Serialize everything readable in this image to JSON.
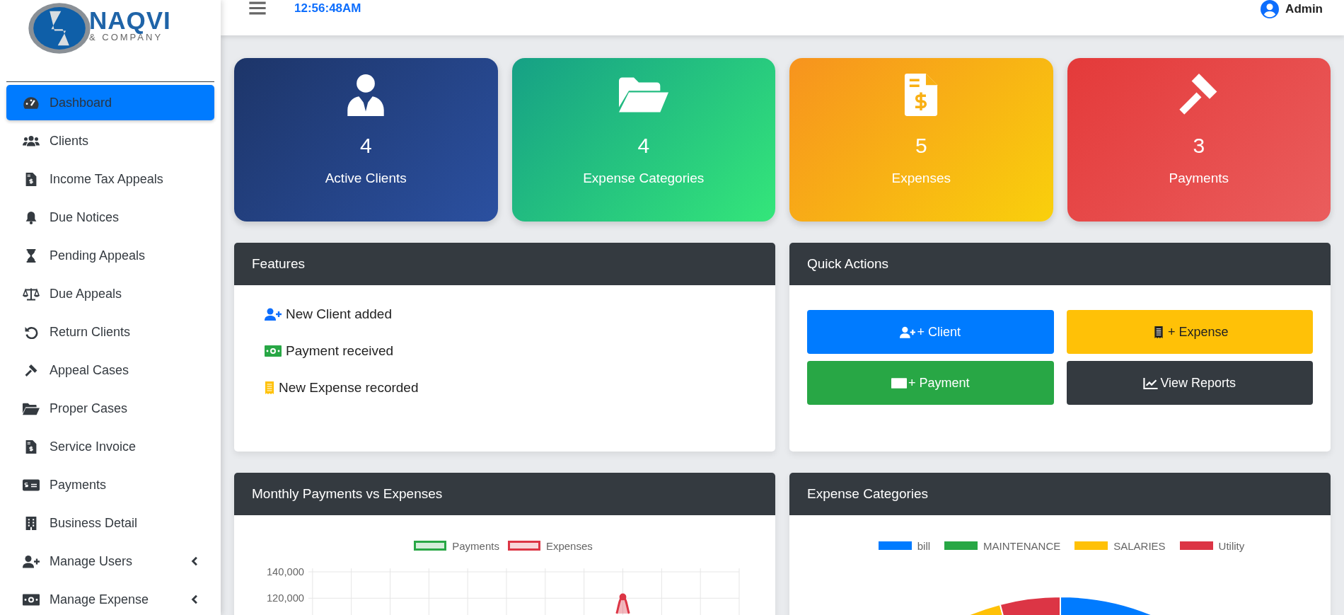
{
  "brand": {
    "name": "NAQVI",
    "tagline": "& COMPANY"
  },
  "sidebar": {
    "items": [
      {
        "label": "Dashboard",
        "kind": "gauge",
        "selected": true,
        "submenu": false
      },
      {
        "label": "Clients",
        "kind": "users",
        "selected": false,
        "submenu": false
      },
      {
        "label": "Income Tax Appeals",
        "kind": "invoice",
        "selected": false,
        "submenu": false
      },
      {
        "label": "Due Notices",
        "kind": "bell",
        "selected": false,
        "submenu": false
      },
      {
        "label": "Pending Appeals",
        "kind": "hourglass",
        "selected": false,
        "submenu": false
      },
      {
        "label": "Due Appeals",
        "kind": "scale",
        "selected": false,
        "submenu": false
      },
      {
        "label": "Return Clients",
        "kind": "undo",
        "selected": false,
        "submenu": false
      },
      {
        "label": "Appeal Cases",
        "kind": "gavel",
        "selected": false,
        "submenu": false
      },
      {
        "label": "Proper Cases",
        "kind": "folder",
        "selected": false,
        "submenu": false
      },
      {
        "label": "Service Invoice",
        "kind": "invoice",
        "selected": false,
        "submenu": false
      },
      {
        "label": "Payments",
        "kind": "cheque",
        "selected": false,
        "submenu": false
      },
      {
        "label": "Business Detail",
        "kind": "building",
        "selected": false,
        "submenu": false
      },
      {
        "label": "Manage Users",
        "kind": "user-plus",
        "selected": false,
        "submenu": true
      },
      {
        "label": "Manage Expense",
        "kind": "money",
        "selected": false,
        "submenu": true
      }
    ]
  },
  "header": {
    "time": "12:56:48AM",
    "user": "Admin"
  },
  "stat_cards": [
    {
      "kind": "clients",
      "value": "4",
      "label": "Active Clients"
    },
    {
      "kind": "categories",
      "value": "4",
      "label": "Expense Categories"
    },
    {
      "kind": "expenses",
      "value": "5",
      "label": "Expenses"
    },
    {
      "kind": "payments",
      "value": "3",
      "label": "Payments"
    }
  ],
  "features": {
    "title": "Features",
    "items": [
      {
        "kind": "client",
        "text": "New Client added"
      },
      {
        "kind": "payment",
        "text": "Payment received"
      },
      {
        "kind": "expense",
        "text": "New Expense recorded"
      }
    ]
  },
  "quick_actions": {
    "title": "Quick Actions",
    "buttons": [
      {
        "kind": "client",
        "label": "+ Client"
      },
      {
        "kind": "expense",
        "label": "+ Expense"
      },
      {
        "kind": "payment",
        "label": "+ Payment"
      },
      {
        "kind": "reports",
        "label": "View Reports"
      }
    ]
  },
  "monthly_chart": {
    "title": "Monthly Payments vs Expenses",
    "legend": [
      {
        "label": "Payments",
        "color": "#28a745"
      },
      {
        "label": "Expenses",
        "color": "#dc3545"
      }
    ],
    "y_axis_labels": [
      "140,000",
      "120,000"
    ]
  },
  "expense_chart": {
    "title": "Expense Categories",
    "legend": [
      {
        "label": "bill",
        "color": "#007bff"
      },
      {
        "label": "MAINTENANCE",
        "color": "#28a745"
      },
      {
        "label": "SALARIES",
        "color": "#ffc107"
      },
      {
        "label": "Utility",
        "color": "#dc3545"
      }
    ]
  }
}
